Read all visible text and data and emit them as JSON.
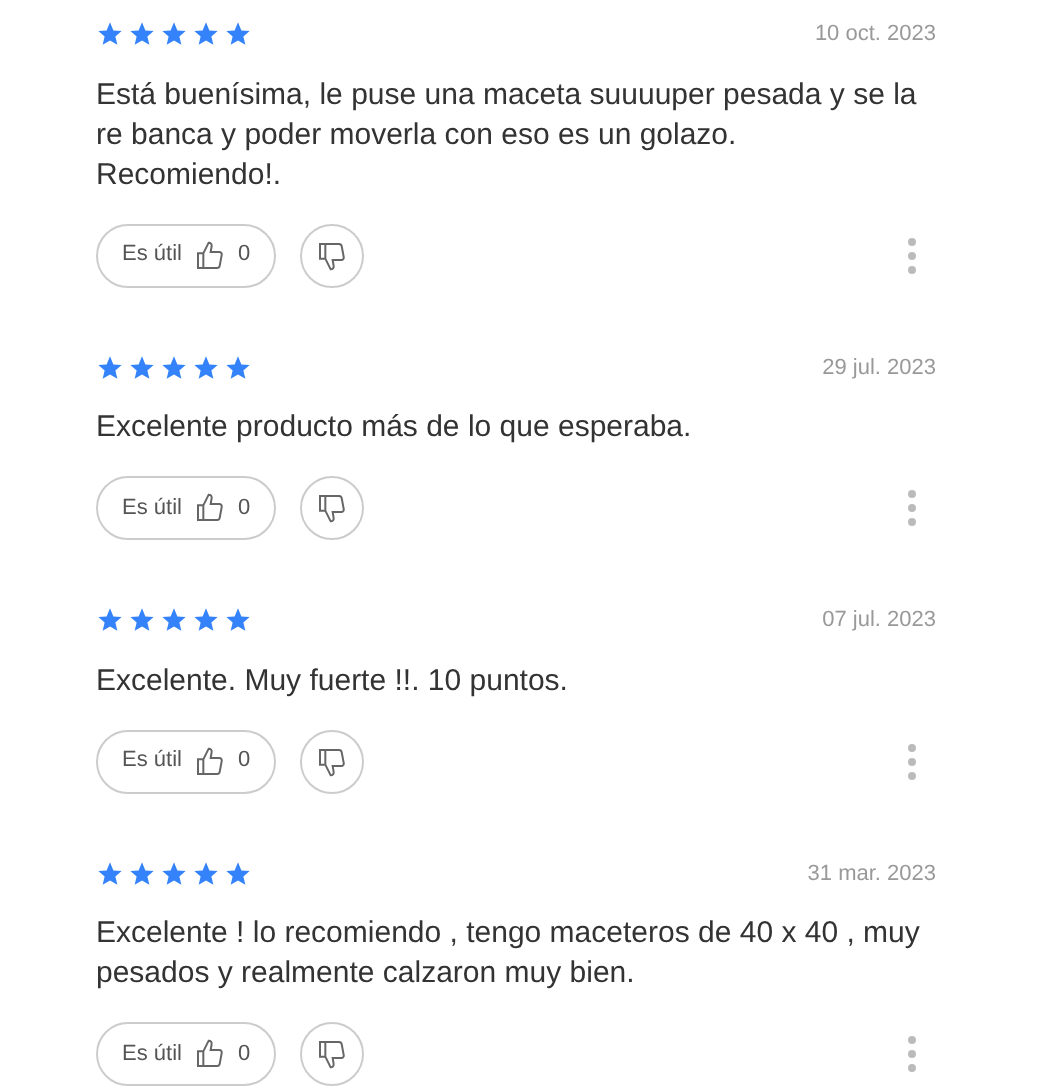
{
  "reviews": [
    {
      "stars": 5,
      "date": "10 oct. 2023",
      "text": "Está buenísima, le puse una maceta suuuuper pesada y se la re banca y poder moverla con eso es un golazo. Recomiendo!.",
      "helpful_label": "Es útil",
      "helpful_count": "0"
    },
    {
      "stars": 5,
      "date": "29 jul. 2023",
      "text": "Excelente producto más de lo que esperaba.",
      "helpful_label": "Es útil",
      "helpful_count": "0"
    },
    {
      "stars": 5,
      "date": "07 jul. 2023",
      "text": "Excelente. Muy fuerte !!. 10 puntos.",
      "helpful_label": "Es útil",
      "helpful_count": "0"
    },
    {
      "stars": 5,
      "date": "31 mar. 2023",
      "text": "Excelente ! lo recomiendo , tengo maceteros de 40 x 40 , muy pesados y realmente calzaron muy bien.",
      "helpful_label": "Es útil",
      "helpful_count": "0"
    }
  ]
}
